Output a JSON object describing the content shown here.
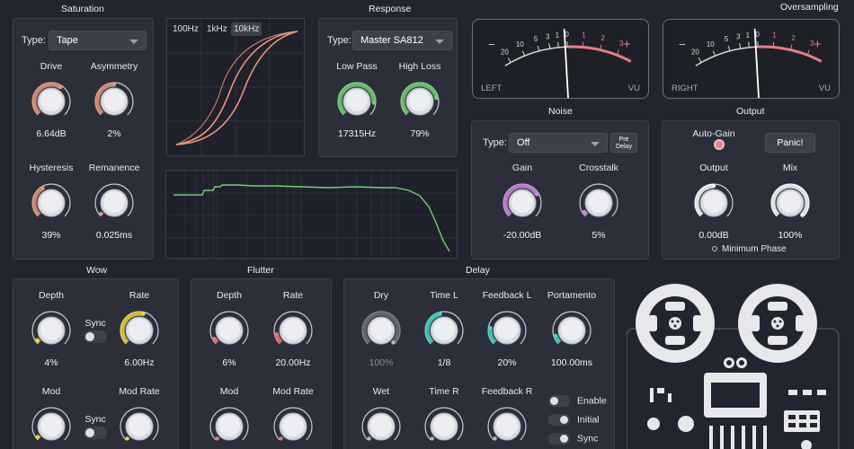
{
  "saturation": {
    "title": "Saturation",
    "type_label": "Type:",
    "type_value": "Tape",
    "knobs": [
      {
        "label": "Drive",
        "value": "6.64dB",
        "level": 0.62,
        "color": "#e9957b"
      },
      {
        "label": "Asymmetry",
        "value": "2%",
        "level": 0.5,
        "color": "#e9957b"
      },
      {
        "label": "Hysteresis",
        "value": "39%",
        "level": 0.39,
        "color": "#e9957b"
      },
      {
        "label": "Remanence",
        "value": "0.025ms",
        "level": 0.02,
        "color": "#e9957b"
      }
    ]
  },
  "response_graph": {
    "freq_tabs": [
      "100Hz",
      "1kHz",
      "10kHz"
    ],
    "active_tab": "10kHz"
  },
  "response": {
    "title": "Response",
    "type_label": "Type:",
    "type_value": "Master SA812",
    "knobs": [
      {
        "label": "Low Pass",
        "value": "17315Hz",
        "level": 0.85,
        "color": "#6fd36f"
      },
      {
        "label": "High Loss",
        "value": "79%",
        "level": 0.79,
        "color": "#6fd36f"
      }
    ]
  },
  "oversampling": {
    "title": "Oversampling"
  },
  "vu_meters": [
    {
      "side": "LEFT",
      "unit": "VU",
      "scale": [
        "20",
        "10",
        "5",
        "3",
        "1",
        "0",
        "1",
        "2",
        "3"
      ],
      "minus": "−",
      "plus": "+"
    },
    {
      "side": "RIGHT",
      "unit": "VU",
      "scale": [
        "20",
        "10",
        "5",
        "3",
        "1",
        "0",
        "1",
        "2",
        "3"
      ],
      "minus": "−",
      "plus": "+"
    }
  ],
  "noise": {
    "title": "Noise",
    "type_label": "Type:",
    "type_value": "Off",
    "pre_delay_line1": "Pre",
    "pre_delay_line2": "Delay",
    "knobs": [
      {
        "label": "Gain",
        "value": "-20.00dB",
        "level": 0.72,
        "color": "#c98be0"
      },
      {
        "label": "Crosstalk",
        "value": "5%",
        "level": 0.05,
        "color": "#c98be0"
      }
    ]
  },
  "output": {
    "title": "Output",
    "auto_gain_label": "Auto-Gain",
    "panic_label": "Panic!",
    "min_phase_label": "Minimum Phase",
    "knobs": [
      {
        "label": "Output",
        "value": "0.00dB",
        "level": 0.5,
        "color": "#ffffff"
      },
      {
        "label": "Mix",
        "value": "100%",
        "level": 1.0,
        "color": "#ffffff"
      }
    ]
  },
  "wow": {
    "title": "Wow",
    "sync_label": "Sync",
    "knobs": [
      {
        "label": "Depth",
        "value": "4%",
        "level": 0.04,
        "color": "#f2d23c"
      },
      {
        "label": "Rate",
        "value": "6.00Hz",
        "level": 0.55,
        "color": "#f2d23c"
      },
      {
        "label": "Mod",
        "value": "",
        "level": 0.03,
        "color": "#f2d23c"
      },
      {
        "label": "Mod Rate",
        "value": "",
        "level": 0.0,
        "color": "#f2d23c"
      }
    ]
  },
  "flutter": {
    "title": "Flutter",
    "knobs": [
      {
        "label": "Depth",
        "value": "6%",
        "level": 0.06,
        "color": "#f0757a"
      },
      {
        "label": "Rate",
        "value": "20.00Hz",
        "level": 0.12,
        "color": "#f0757a"
      },
      {
        "label": "Mod",
        "value": "",
        "level": 0.0,
        "color": "#f0757a"
      },
      {
        "label": "Mod Rate",
        "value": "",
        "level": 0.0,
        "color": "#f0757a"
      }
    ]
  },
  "delay": {
    "title": "Delay",
    "knobs": [
      {
        "label": "Dry",
        "value": "100%",
        "level": 1.0,
        "color": "#6a6e78",
        "dim": true
      },
      {
        "label": "Time L",
        "value": "1/8",
        "level": 0.45,
        "color": "#46d6c8"
      },
      {
        "label": "Feedback L",
        "value": "20%",
        "level": 0.2,
        "color": "#46d6c8"
      },
      {
        "label": "Portamento",
        "value": "100.00ms",
        "level": 0.1,
        "color": "#46d6c8"
      },
      {
        "label": "Wet",
        "value": "",
        "level": 0.0,
        "color": "#6a6e78"
      },
      {
        "label": "Time R",
        "value": "",
        "level": 0.0,
        "color": "#6a6e78"
      },
      {
        "label": "Feedback R",
        "value": "",
        "level": 0.0,
        "color": "#6a6e78"
      }
    ],
    "toggles": [
      "Enable",
      "Initial",
      "Sync"
    ]
  }
}
